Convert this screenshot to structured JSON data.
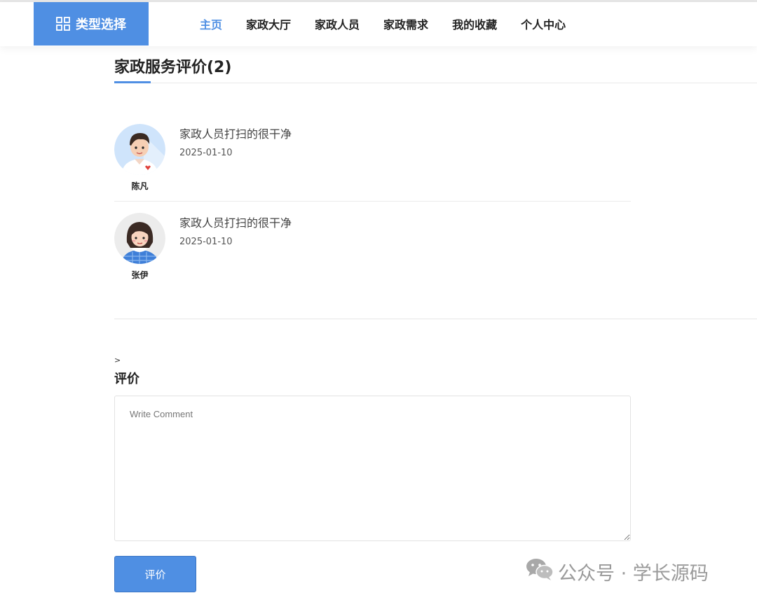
{
  "nav": {
    "type_select_label": "类型选择",
    "links": [
      "主页",
      "家政大厅",
      "家政人员",
      "家政需求",
      "我的收藏",
      "个人中心"
    ],
    "active_index": 0
  },
  "reviews_section": {
    "title": "家政服务评价(2)",
    "items": [
      {
        "name": "陈凡",
        "text": "家政人员打扫的很干净",
        "date": "2025-01-10"
      },
      {
        "name": "张伊",
        "text": "家政人员打扫的很干净",
        "date": "2025-01-10"
      }
    ]
  },
  "comment_form": {
    "arrow": ">",
    "heading": "评价",
    "placeholder": "Write Comment",
    "submit_label": "评价"
  },
  "watermark": {
    "text": "公众号 · 学长源码"
  },
  "colors": {
    "accent": "#4f8fe3"
  }
}
